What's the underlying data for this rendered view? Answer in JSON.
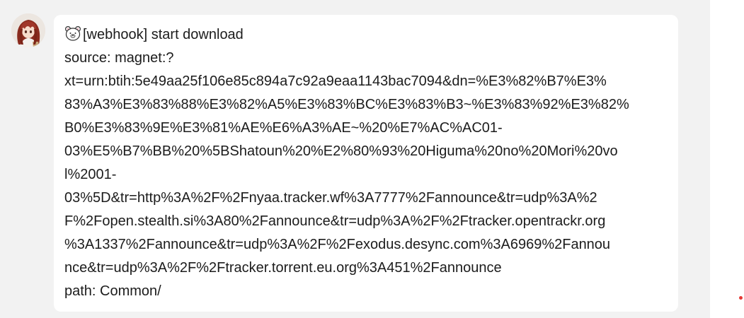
{
  "message": {
    "sender_avatar": "anime-character-avatar",
    "icon": "bear-face-icon",
    "lines": [
      "[webhook] start download",
      "source: magnet:?",
      "xt=urn:btih:5e49aa25f106e85c894a7c92a9eaa1143bac7094&dn=%E3%82%B7%E3%",
      "83%A3%E3%83%88%E3%82%A5%E3%83%BC%E3%83%B3~%E3%83%92%E3%82%",
      "B0%E3%83%9E%E3%81%AE%E6%A3%AE~%20%E7%AC%AC01-",
      "03%E5%B7%BB%20%5BShatoun%20%E2%80%93%20Higuma%20no%20Mori%20vo",
      "l%2001-",
      "03%5D&tr=http%3A%2F%2Fnyaa.tracker.wf%3A7777%2Fannounce&tr=udp%3A%2",
      "F%2Fopen.stealth.si%3A80%2Fannounce&tr=udp%3A%2F%2Ftracker.opentrackr.org",
      "%3A1337%2Fannounce&tr=udp%3A%2F%2Fexodus.desync.com%3A6969%2Fannou",
      "nce&tr=udp%3A%2F%2Ftracker.torrent.eu.org%3A451%2Fannounce",
      "path: Common/"
    ]
  },
  "colors": {
    "background": "#f2f2f2",
    "bubble": "#ffffff",
    "text": "#1c1c1c",
    "notification_dot": "#e53935"
  }
}
